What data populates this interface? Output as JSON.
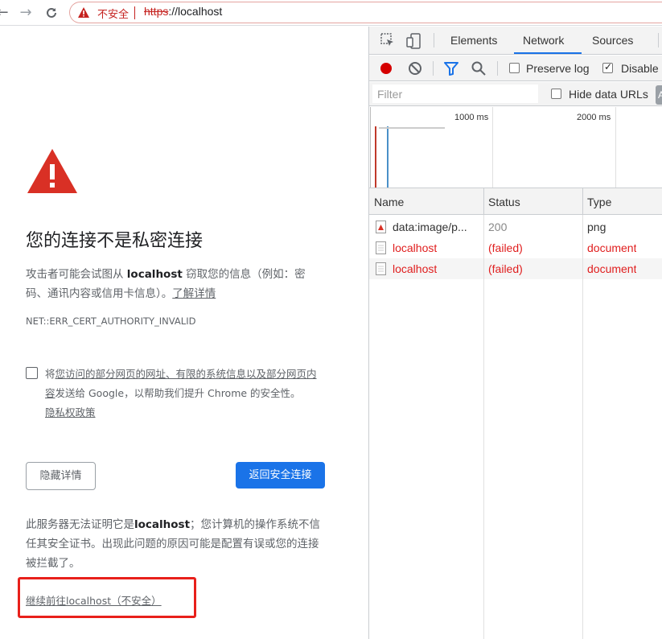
{
  "browser": {
    "back_glyph": "←",
    "forward_glyph": "→",
    "reload_glyph": "C",
    "insecure_label": "不安全",
    "url_scheme": "https",
    "url_rest": "://localhost"
  },
  "interstitial": {
    "title": "您的连接不是私密连接",
    "desc_part1": "攻击者可能会试图从 ",
    "desc_host": "localhost",
    "desc_part2": " 窃取您的信息（例如：密码、通讯内容或信用卡信息）。",
    "learn_more": "了解详情",
    "error_code": "NET::ERR_CERT_AUTHORITY_INVALID",
    "optin_part1": "将",
    "optin_link1": "您访问的部分网页的网址、有限的系统信息以及部分网页内容",
    "optin_part2": "发送给 Google，以帮助我们提升 Chrome 的安全性。",
    "privacy_link": "隐私权政策",
    "hide_details": "隐藏详情",
    "back_to_safety": "返回安全连接",
    "detail_part1": "此服务器无法证明它是",
    "detail_host": "localhost",
    "detail_part2": "；您计算机的操作系统不信任其安全证书。出现此问题的原因可能是配置有误或您的连接被拦截了。",
    "proceed_link": "继续前往localhost（不安全）"
  },
  "devtools": {
    "tabs": [
      "Elements",
      "Network",
      "Sources"
    ],
    "active_tab": "Network",
    "preserve_log": "Preserve log",
    "disable_cache": "Disable",
    "filter_placeholder": "Filter",
    "hide_data_urls": "Hide data URLs",
    "all_pill": "A",
    "ticks": [
      "1000 ms",
      "2000 ms"
    ],
    "columns": [
      "Name",
      "Status",
      "Type"
    ],
    "requests": [
      {
        "name": "data:image/p...",
        "status": "200",
        "type": "png",
        "failed": false,
        "icon": "image-icon"
      },
      {
        "name": "localhost",
        "status": "(failed)",
        "type": "document",
        "failed": true,
        "icon": "document-icon"
      },
      {
        "name": "localhost",
        "status": "(failed)",
        "type": "document",
        "failed": true,
        "icon": "document-icon"
      }
    ],
    "colors": {
      "accent": "#1a73e8",
      "error": "#e01e1e",
      "record": "#d50000"
    }
  }
}
